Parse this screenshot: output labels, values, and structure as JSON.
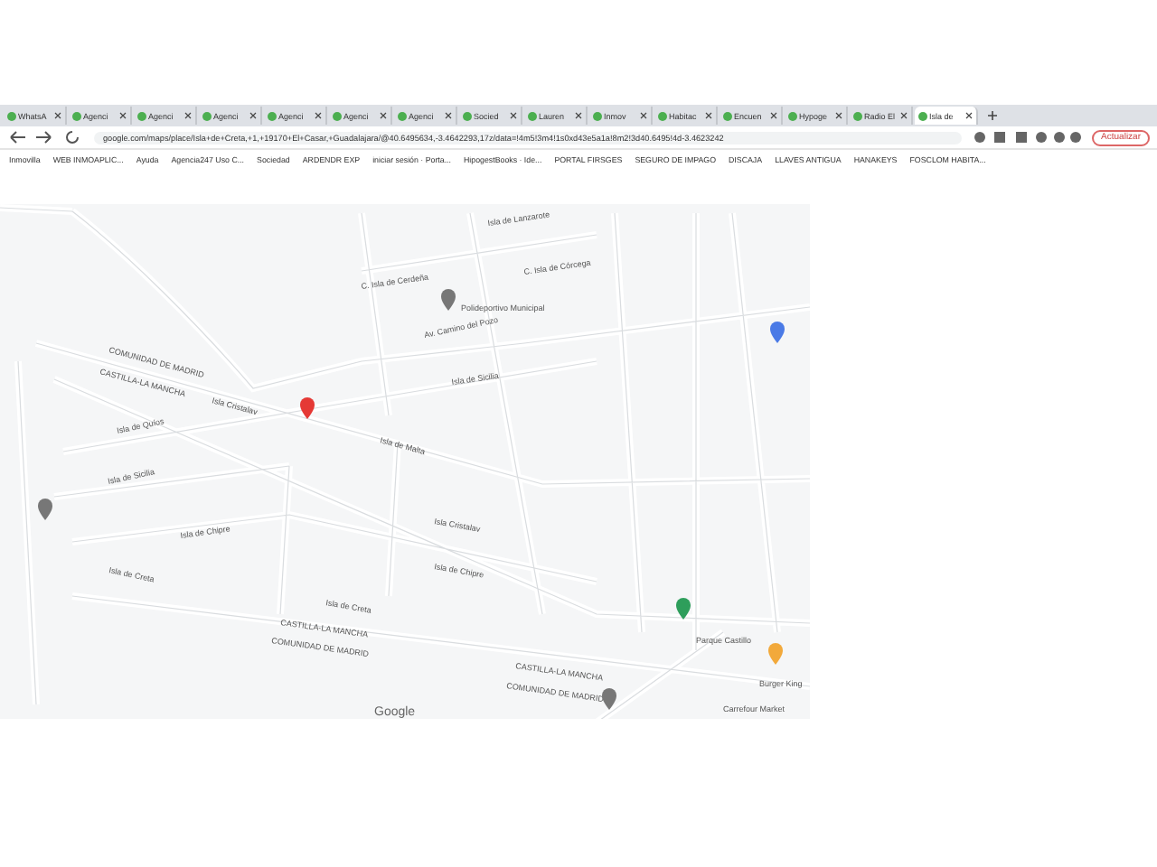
{
  "tabs": [
    {
      "title": "WhatsA",
      "selected": false
    },
    {
      "title": "Agenci",
      "selected": false
    },
    {
      "title": "Agenci",
      "selected": false
    },
    {
      "title": "Agenci",
      "selected": false
    },
    {
      "title": "Agenci",
      "selected": false
    },
    {
      "title": "Agenci",
      "selected": false
    },
    {
      "title": "Agenci",
      "selected": false
    },
    {
      "title": "Socied",
      "selected": false
    },
    {
      "title": "Lauren",
      "selected": false
    },
    {
      "title": "Inmov",
      "selected": false
    },
    {
      "title": "Habitac",
      "selected": false
    },
    {
      "title": "Encuen",
      "selected": false
    },
    {
      "title": "Hypoge",
      "selected": false
    },
    {
      "title": "Radio El",
      "selected": false
    },
    {
      "title": "Isla de",
      "selected": true
    }
  ],
  "address_bar": {
    "url": "google.com/maps/place/Isla+de+Creta,+1,+19170+El+Casar,+Guadalajara/@40.6495634,-3.4642293,17z/data=!4m5!3m4!1s0xd43e5a1a!8m2!3d40.6495!4d-3.4623242"
  },
  "update_button": "Actualizar",
  "bookmarks": [
    "Inmovilla",
    "WEB INMOAPLIC...",
    "Ayuda",
    "Agencia247 Uso C...",
    "Sociedad",
    "ARDENDR EXP",
    "iniciar sesión · Porta...",
    "HipogestBooks · Ide...",
    "PORTAL FIRSGES",
    "SEGURO DE IMPAGO",
    "DISCAJA",
    "LLAVES ANTIGUA",
    "HANAKEYS",
    "FOSCLOM HABITA..."
  ],
  "map": {
    "labels": [
      "Isla de Lanzarote",
      "C. Isla de Córcega",
      "C. Isla de Cerdeña",
      "Polideportivo Municipal",
      "Av. Camino del Pozo",
      "COMUNIDAD DE MADRID",
      "CASTILLA-LA MANCHA",
      "Isla Cristalav",
      "Isla de Sicilia",
      "Isla de Quíos",
      "Isla de Malta",
      "Isla de Sicilia",
      "Isla Cristalav",
      "Isla de Chipre",
      "Isla de Chipre",
      "Isla de Creta",
      "Isla de Creta",
      "CASTILLA-LA MANCHA",
      "COMUNIDAD DE MADRID",
      "CASTILLA-LA MANCHA",
      "COMUNIDAD DE MADRID",
      "Parque Castillo",
      "Burger King",
      "Carrefour Market"
    ],
    "attribution": "Google"
  }
}
